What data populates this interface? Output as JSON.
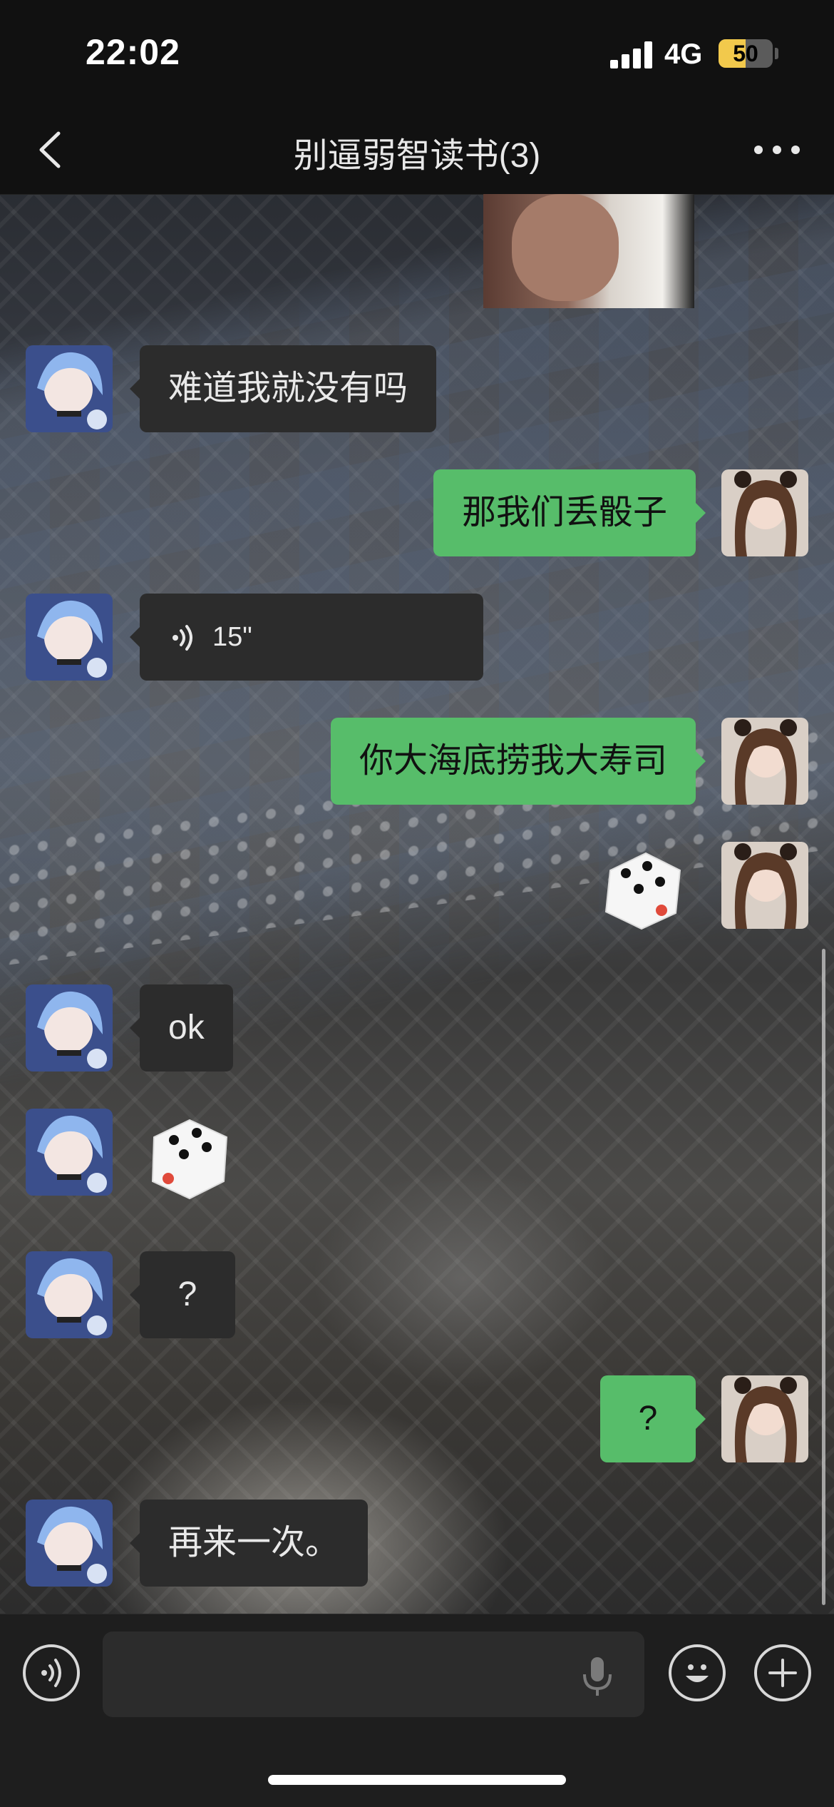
{
  "status_bar": {
    "time": "22:02",
    "network": "4G",
    "battery": "50",
    "battery_level": 0.5
  },
  "nav": {
    "title": "别逼弱智读书(3)"
  },
  "messages": [
    {
      "type": "text",
      "side": "in",
      "text": "难道我就没有吗"
    },
    {
      "type": "text",
      "side": "out",
      "text": "那我们丢骰子"
    },
    {
      "type": "voice",
      "side": "in",
      "duration": "15\""
    },
    {
      "type": "text",
      "side": "out",
      "text": "你大海底捞我大寿司"
    },
    {
      "type": "dice",
      "side": "out",
      "value": 4
    },
    {
      "type": "text",
      "side": "in",
      "text": "ok"
    },
    {
      "type": "dice",
      "side": "in",
      "value": 4
    },
    {
      "type": "text",
      "side": "in",
      "text": "?"
    },
    {
      "type": "text",
      "side": "out",
      "text": "?"
    },
    {
      "type": "text",
      "side": "in",
      "text": "再来一次。"
    }
  ],
  "icons": {
    "back": "chevron-left-icon",
    "more": "more-dots-icon",
    "voice_mode": "voice-mode-icon",
    "mic": "microphone-icon",
    "emoji": "emoji-icon",
    "plus": "plus-icon"
  },
  "colors": {
    "outgoing_bubble": "#57bd6a",
    "incoming_bubble": "#2c2c2c",
    "background": "#111111"
  }
}
